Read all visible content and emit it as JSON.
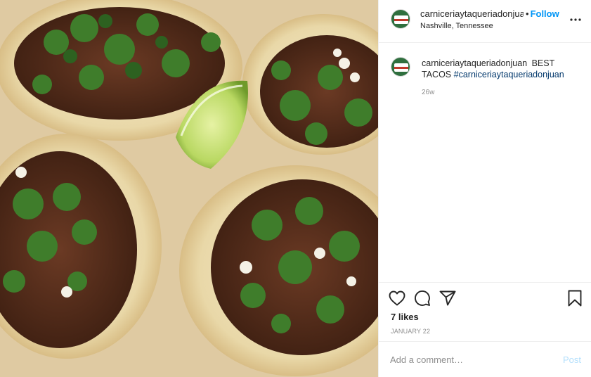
{
  "post": {
    "username": "carniceriaytaqueriadonjuan",
    "username_display": "carniceriaytaqueriadonjua",
    "follow_separator": "•",
    "follow_label": "Follow",
    "location": "Nashville, Tennessee",
    "more_icon": "more-horizontal-icon",
    "photo_subject": "tacos"
  },
  "caption": {
    "username": "carniceriaytaqueriadonjuan",
    "text": "BEST TACOS",
    "hashtag": "#carniceriaytaqueriadonjuan",
    "time_ago": "26w"
  },
  "actions": {
    "icons": [
      "heart-icon",
      "comment-icon",
      "share-icon",
      "bookmark-icon"
    ],
    "likes": "7 likes",
    "date": "JANUARY 22"
  },
  "comment_box": {
    "placeholder": "Add a comment…",
    "post_label": "Post"
  },
  "colors": {
    "link_blue": "#0095f6",
    "post_disabled": "#b2dffc",
    "muted": "#8e8e8e",
    "divider": "#efefef"
  }
}
